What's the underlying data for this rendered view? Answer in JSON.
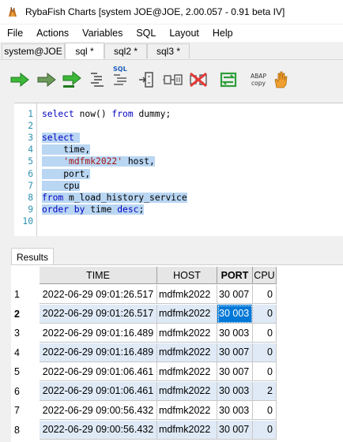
{
  "window": {
    "title": "RybaFish Charts [system JOE@JOE, 2.00.057 - 0.91 beta IV]"
  },
  "menu": [
    "File",
    "Actions",
    "Variables",
    "SQL",
    "Layout",
    "Help"
  ],
  "tabs": [
    "system@JOE",
    "sql *",
    "sql2 *",
    "sql3 *"
  ],
  "toolbar": {
    "items": [
      {
        "name": "execute-icon",
        "color": "#3db83a"
      },
      {
        "name": "execute-current-icon",
        "color": "#5a9a48"
      },
      {
        "name": "execute-all-icon",
        "color": "#3db83a"
      },
      {
        "name": "format-sql-icon",
        "color": "#444444"
      },
      {
        "name": "sql-icon",
        "label": "SQL",
        "color": "#1f5fbf"
      },
      {
        "name": "explain-plan-icon",
        "color": "#444444"
      },
      {
        "name": "connect-icon",
        "color": "#444444"
      },
      {
        "name": "disconnect-icon",
        "color": "#e53935"
      },
      {
        "name": "refresh-icon",
        "color": "#2e9e3a"
      },
      {
        "name": "abap-copy-icon",
        "label": "ABAP copy",
        "color": "#333333"
      },
      {
        "name": "hand-icon",
        "color": "#f0a030"
      }
    ]
  },
  "editor": {
    "lines": [
      {
        "n": "1",
        "segments": [
          {
            "t": "select",
            "c": "kw"
          },
          {
            "t": " now() "
          },
          {
            "t": "from",
            "c": "kw"
          },
          {
            "t": " dummy;"
          }
        ],
        "selected": false
      },
      {
        "n": "2",
        "segments": [],
        "selected": false
      },
      {
        "n": "3",
        "segments": [
          {
            "t": "select",
            "c": "kw"
          },
          {
            "t": " "
          }
        ],
        "selected": true
      },
      {
        "n": "4",
        "segments": [
          {
            "t": "    time,"
          }
        ],
        "selected": true
      },
      {
        "n": "5",
        "segments": [
          {
            "t": "    "
          },
          {
            "t": "'mdfmk2022'",
            "c": "str"
          },
          {
            "t": " host,"
          }
        ],
        "selected": true
      },
      {
        "n": "6",
        "segments": [
          {
            "t": "    port,"
          }
        ],
        "selected": true
      },
      {
        "n": "7",
        "segments": [
          {
            "t": "    cpu"
          }
        ],
        "selected": true
      },
      {
        "n": "8",
        "segments": [
          {
            "t": "from",
            "c": "kw"
          },
          {
            "t": " m_load_history_service"
          }
        ],
        "selected": true
      },
      {
        "n": "9",
        "segments": [
          {
            "t": "order by",
            "c": "kw"
          },
          {
            "t": " time "
          },
          {
            "t": "desc",
            "c": "kw"
          },
          {
            "t": ";"
          }
        ],
        "selected": true
      },
      {
        "n": "10",
        "segments": [],
        "selected": false
      }
    ]
  },
  "results": {
    "tab_label": "Results",
    "columns": [
      "TIME",
      "HOST",
      "PORT",
      "CPU"
    ],
    "rows": [
      {
        "n": "1",
        "time": "2022-06-29 09:01:26.517",
        "host": "mdfmk2022",
        "port": "30 007",
        "cpu": "0"
      },
      {
        "n": "2",
        "time": "2022-06-29 09:01:26.517",
        "host": "mdfmk2022",
        "port": "30 003",
        "cpu": "0"
      },
      {
        "n": "3",
        "time": "2022-06-29 09:01:16.489",
        "host": "mdfmk2022",
        "port": "30 003",
        "cpu": "0"
      },
      {
        "n": "4",
        "time": "2022-06-29 09:01:16.489",
        "host": "mdfmk2022",
        "port": "30 007",
        "cpu": "0"
      },
      {
        "n": "5",
        "time": "2022-06-29 09:01:06.461",
        "host": "mdfmk2022",
        "port": "30 007",
        "cpu": "0"
      },
      {
        "n": "6",
        "time": "2022-06-29 09:01:06.461",
        "host": "mdfmk2022",
        "port": "30 003",
        "cpu": "2"
      },
      {
        "n": "7",
        "time": "2022-06-29 09:00:56.432",
        "host": "mdfmk2022",
        "port": "30 003",
        "cpu": "0"
      },
      {
        "n": "8",
        "time": "2022-06-29 09:00:56.432",
        "host": "mdfmk2022",
        "port": "30 007",
        "cpu": "0"
      }
    ],
    "current_row": 2,
    "selected_column": "PORT"
  }
}
